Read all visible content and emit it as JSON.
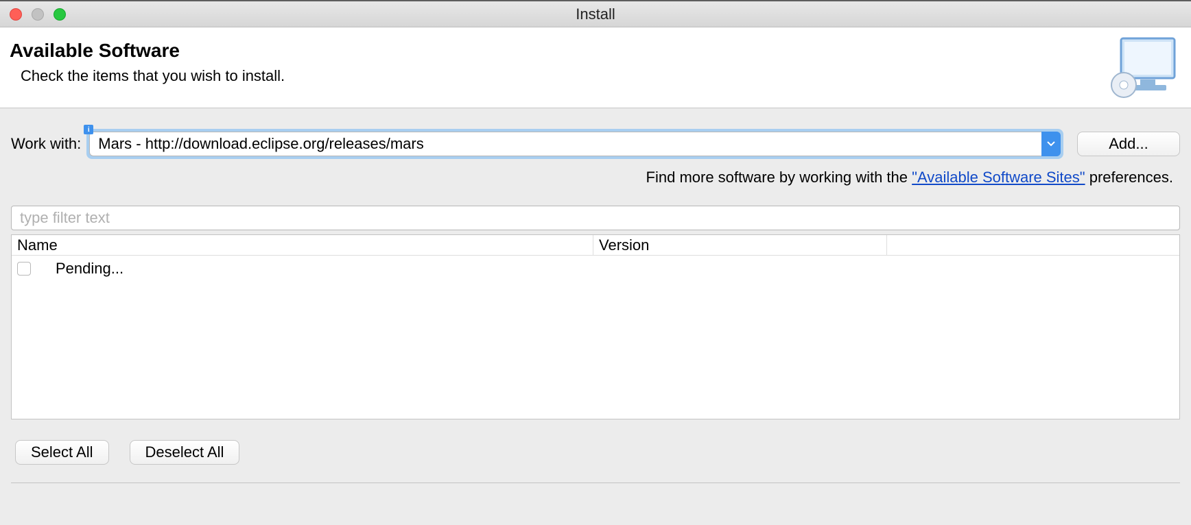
{
  "window": {
    "title": "Install"
  },
  "header": {
    "title": "Available Software",
    "subtitle": "Check the items that you wish to install."
  },
  "work_with": {
    "label": "Work with:",
    "value": "Mars - http://download.eclipse.org/releases/mars",
    "add_label": "Add..."
  },
  "hint": {
    "prefix": "Find more software by working with the ",
    "link": "\"Available Software Sites\"",
    "suffix": " preferences."
  },
  "filter": {
    "placeholder": "type filter text"
  },
  "table": {
    "columns": {
      "name": "Name",
      "version": "Version"
    },
    "rows": [
      {
        "name": "Pending..."
      }
    ]
  },
  "buttons": {
    "select_all": "Select All",
    "deselect_all": "Deselect All"
  },
  "icons": {
    "monitor": "monitor-install-icon",
    "dropdown": "chevron-down-icon",
    "info": "info-badge-icon"
  }
}
